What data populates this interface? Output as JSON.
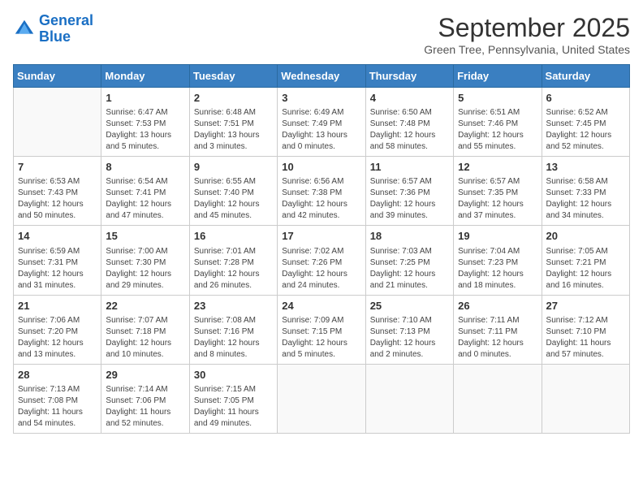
{
  "logo": {
    "line1": "General",
    "line2": "Blue"
  },
  "title": "September 2025",
  "subtitle": "Green Tree, Pennsylvania, United States",
  "weekdays": [
    "Sunday",
    "Monday",
    "Tuesday",
    "Wednesday",
    "Thursday",
    "Friday",
    "Saturday"
  ],
  "weeks": [
    [
      {
        "day": "",
        "info": ""
      },
      {
        "day": "1",
        "info": "Sunrise: 6:47 AM\nSunset: 7:53 PM\nDaylight: 13 hours\nand 5 minutes."
      },
      {
        "day": "2",
        "info": "Sunrise: 6:48 AM\nSunset: 7:51 PM\nDaylight: 13 hours\nand 3 minutes."
      },
      {
        "day": "3",
        "info": "Sunrise: 6:49 AM\nSunset: 7:49 PM\nDaylight: 13 hours\nand 0 minutes."
      },
      {
        "day": "4",
        "info": "Sunrise: 6:50 AM\nSunset: 7:48 PM\nDaylight: 12 hours\nand 58 minutes."
      },
      {
        "day": "5",
        "info": "Sunrise: 6:51 AM\nSunset: 7:46 PM\nDaylight: 12 hours\nand 55 minutes."
      },
      {
        "day": "6",
        "info": "Sunrise: 6:52 AM\nSunset: 7:45 PM\nDaylight: 12 hours\nand 52 minutes."
      }
    ],
    [
      {
        "day": "7",
        "info": "Sunrise: 6:53 AM\nSunset: 7:43 PM\nDaylight: 12 hours\nand 50 minutes."
      },
      {
        "day": "8",
        "info": "Sunrise: 6:54 AM\nSunset: 7:41 PM\nDaylight: 12 hours\nand 47 minutes."
      },
      {
        "day": "9",
        "info": "Sunrise: 6:55 AM\nSunset: 7:40 PM\nDaylight: 12 hours\nand 45 minutes."
      },
      {
        "day": "10",
        "info": "Sunrise: 6:56 AM\nSunset: 7:38 PM\nDaylight: 12 hours\nand 42 minutes."
      },
      {
        "day": "11",
        "info": "Sunrise: 6:57 AM\nSunset: 7:36 PM\nDaylight: 12 hours\nand 39 minutes."
      },
      {
        "day": "12",
        "info": "Sunrise: 6:57 AM\nSunset: 7:35 PM\nDaylight: 12 hours\nand 37 minutes."
      },
      {
        "day": "13",
        "info": "Sunrise: 6:58 AM\nSunset: 7:33 PM\nDaylight: 12 hours\nand 34 minutes."
      }
    ],
    [
      {
        "day": "14",
        "info": "Sunrise: 6:59 AM\nSunset: 7:31 PM\nDaylight: 12 hours\nand 31 minutes."
      },
      {
        "day": "15",
        "info": "Sunrise: 7:00 AM\nSunset: 7:30 PM\nDaylight: 12 hours\nand 29 minutes."
      },
      {
        "day": "16",
        "info": "Sunrise: 7:01 AM\nSunset: 7:28 PM\nDaylight: 12 hours\nand 26 minutes."
      },
      {
        "day": "17",
        "info": "Sunrise: 7:02 AM\nSunset: 7:26 PM\nDaylight: 12 hours\nand 24 minutes."
      },
      {
        "day": "18",
        "info": "Sunrise: 7:03 AM\nSunset: 7:25 PM\nDaylight: 12 hours\nand 21 minutes."
      },
      {
        "day": "19",
        "info": "Sunrise: 7:04 AM\nSunset: 7:23 PM\nDaylight: 12 hours\nand 18 minutes."
      },
      {
        "day": "20",
        "info": "Sunrise: 7:05 AM\nSunset: 7:21 PM\nDaylight: 12 hours\nand 16 minutes."
      }
    ],
    [
      {
        "day": "21",
        "info": "Sunrise: 7:06 AM\nSunset: 7:20 PM\nDaylight: 12 hours\nand 13 minutes."
      },
      {
        "day": "22",
        "info": "Sunrise: 7:07 AM\nSunset: 7:18 PM\nDaylight: 12 hours\nand 10 minutes."
      },
      {
        "day": "23",
        "info": "Sunrise: 7:08 AM\nSunset: 7:16 PM\nDaylight: 12 hours\nand 8 minutes."
      },
      {
        "day": "24",
        "info": "Sunrise: 7:09 AM\nSunset: 7:15 PM\nDaylight: 12 hours\nand 5 minutes."
      },
      {
        "day": "25",
        "info": "Sunrise: 7:10 AM\nSunset: 7:13 PM\nDaylight: 12 hours\nand 2 minutes."
      },
      {
        "day": "26",
        "info": "Sunrise: 7:11 AM\nSunset: 7:11 PM\nDaylight: 12 hours\nand 0 minutes."
      },
      {
        "day": "27",
        "info": "Sunrise: 7:12 AM\nSunset: 7:10 PM\nDaylight: 11 hours\nand 57 minutes."
      }
    ],
    [
      {
        "day": "28",
        "info": "Sunrise: 7:13 AM\nSunset: 7:08 PM\nDaylight: 11 hours\nand 54 minutes."
      },
      {
        "day": "29",
        "info": "Sunrise: 7:14 AM\nSunset: 7:06 PM\nDaylight: 11 hours\nand 52 minutes."
      },
      {
        "day": "30",
        "info": "Sunrise: 7:15 AM\nSunset: 7:05 PM\nDaylight: 11 hours\nand 49 minutes."
      },
      {
        "day": "",
        "info": ""
      },
      {
        "day": "",
        "info": ""
      },
      {
        "day": "",
        "info": ""
      },
      {
        "day": "",
        "info": ""
      }
    ]
  ]
}
